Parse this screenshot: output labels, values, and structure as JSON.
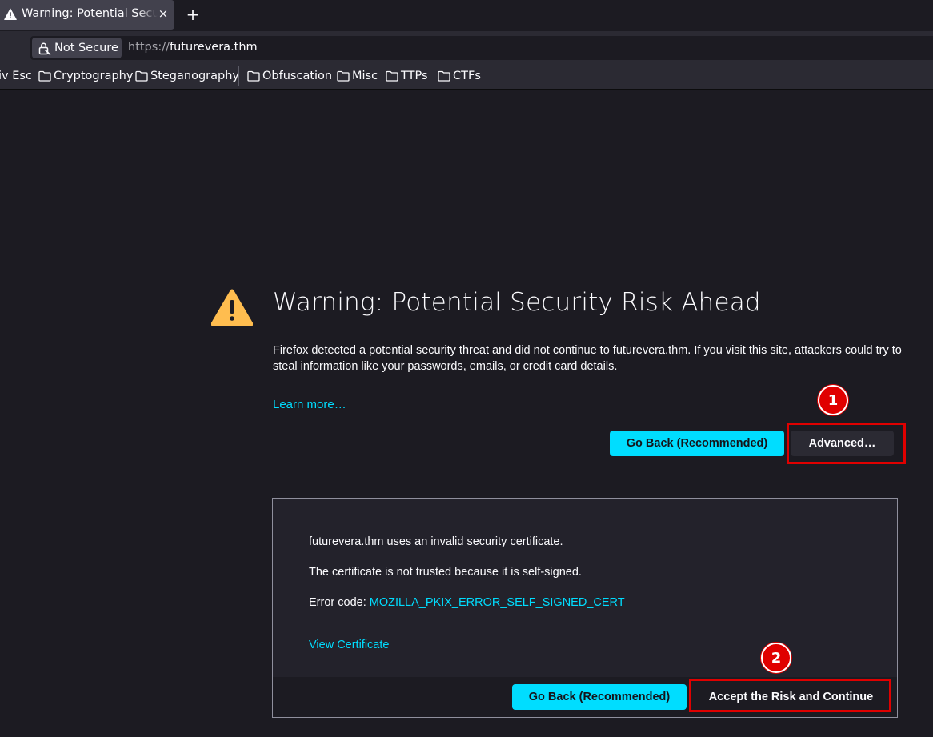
{
  "tab": {
    "title": "Warning: Potential Security Risk Ahead",
    "close": "×",
    "new_tab": "+"
  },
  "navbar": {
    "security_label": "Not Secure",
    "url_scheme": "https://",
    "url_host": "futurevera.thm"
  },
  "bookmarks": [
    {
      "label": "iv Esc"
    },
    {
      "label": "Cryptography"
    },
    {
      "label": "Steganography"
    },
    {
      "label": "Obfuscation"
    },
    {
      "label": "Misc"
    },
    {
      "label": "TTPs"
    },
    {
      "label": "CTFs"
    }
  ],
  "page": {
    "title": "Warning: Potential Security Risk Ahead",
    "description": "Firefox detected a potential security threat and did not continue to futurevera.thm. If you visit this site, attackers could try to steal information like your passwords, emails, or credit card details.",
    "learn_more": "Learn more…",
    "go_back": "Go Back (Recommended)",
    "advanced": "Advanced…"
  },
  "advanced_panel": {
    "line1": "futurevera.thm uses an invalid security certificate.",
    "line2": "The certificate is not trusted because it is self-signed.",
    "error_code_label": "Error code: ",
    "error_code": "MOZILLA_PKIX_ERROR_SELF_SIGNED_CERT",
    "view_certificate": "View Certificate",
    "go_back": "Go Back (Recommended)",
    "accept": "Accept the Risk and Continue"
  },
  "annotations": {
    "marker1": "1",
    "marker2": "2",
    "highlight_color": "#e00000"
  },
  "colors": {
    "accent": "#00ddff",
    "background": "#1c1b22",
    "warning": "#ffbd4f"
  }
}
